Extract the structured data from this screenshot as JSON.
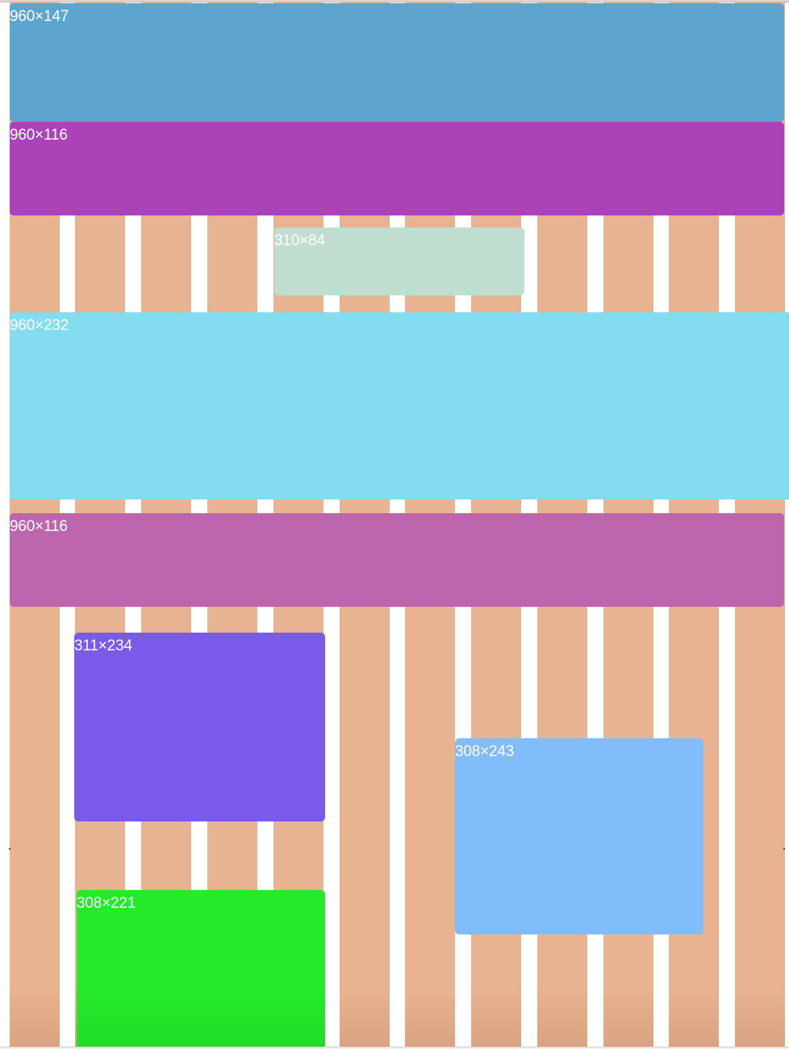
{
  "colors": {
    "page_background": "#ffffff",
    "grid_column": "#e8b390",
    "label_text": "#ffffff"
  },
  "boxes": [
    {
      "label": "960×147",
      "color": "#5da5cf"
    },
    {
      "label": "960×116",
      "color": "#aa43b7"
    },
    {
      "label": "310×84",
      "color": "#bfdecf"
    },
    {
      "label": "960×232",
      "color": "#84dcf0"
    },
    {
      "label": "960×116",
      "color": "#bd66ae"
    },
    {
      "label": "311×234",
      "color": "#7a5ae8"
    },
    {
      "label": "308×243",
      "color": "#80bdfa"
    },
    {
      "label": "308×221",
      "color": "#25e92b"
    }
  ]
}
